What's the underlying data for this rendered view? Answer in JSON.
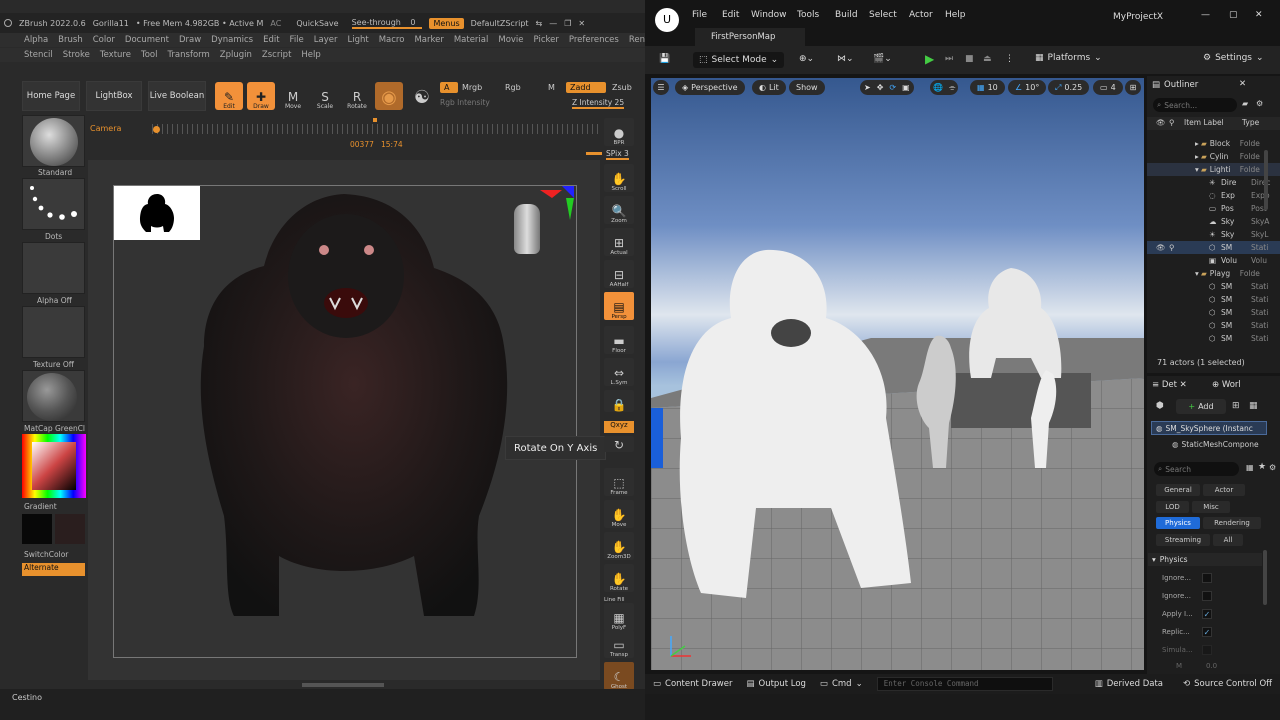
{
  "zbrush": {
    "title": {
      "app": "ZBrush 2022.0.6",
      "doc": "Gorilla11",
      "mem": "• Free Mem 4.982GB • Active M",
      "ac": "AC",
      "quicksave": "QuickSave",
      "seethrough": "See-through",
      "seethrough_val": "0",
      "menus": "Menus",
      "script": "DefaultZScript"
    },
    "menu1": [
      "Alpha",
      "Brush",
      "Color",
      "Document",
      "Draw",
      "Dynamics",
      "Edit",
      "File",
      "Layer",
      "Light",
      "Macro",
      "Marker",
      "Material",
      "Movie",
      "Picker",
      "Preferences",
      "Render"
    ],
    "menu2": [
      "Stencil",
      "Stroke",
      "Texture",
      "Tool",
      "Transform",
      "Zplugin",
      "Zscript",
      "Help"
    ],
    "toolbar": {
      "home": "Home Page",
      "lightbox": "LightBox",
      "livebool": "Live Boolean",
      "edit": "Edit",
      "draw": "Draw",
      "move": "Move",
      "scale": "Scale",
      "rotate": "Rotate",
      "a": "A",
      "mrgb": "Mrgb",
      "rgb": "Rgb",
      "m": "M",
      "zadd": "Zadd",
      "zsub": "Zsub",
      "rgb_intensity": "Rgb Intensity",
      "z_intensity": "Z Intensity 25"
    },
    "timeline": {
      "camera": "Camera",
      "frame": "00377",
      "time": "15:74"
    },
    "left": {
      "standard": "Standard",
      "dots": "Dots",
      "alpha": "Alpha Off",
      "texture": "Texture Off",
      "matcap": "MatCap GreenCl",
      "gradient": "Gradient",
      "switchcolor": "SwitchColor",
      "alternate": "Alternate"
    },
    "right": {
      "bpr": "BPR",
      "spix": "SPix 3",
      "scroll": "Scroll",
      "zoom": "Zoom",
      "actual": "Actual",
      "aahalf": "AAHalf",
      "persp": "Persp",
      "floor": "Floor",
      "lsym": "L.Sym",
      "xyz": "Qxyz",
      "frame": "Frame",
      "move": "Move",
      "zoom3d": "Zoom3D",
      "rotate": "Rotate",
      "linefill": "Line Fill",
      "polyf": "PolyF",
      "transp": "Transp",
      "ghost": "Ghost"
    },
    "tooltip": "Rotate On Y Axis",
    "status": "Cestino"
  },
  "ue": {
    "menu": [
      "File",
      "Edit",
      "Window",
      "Tools",
      "Build",
      "Select",
      "Actor",
      "Help"
    ],
    "project": "MyProjectX",
    "tab": "FirstPersonMap",
    "toolbar": {
      "select_mode": "Select Mode",
      "platforms": "Platforms",
      "settings": "Settings"
    },
    "viewport": {
      "perspective": "Perspective",
      "lit": "Lit",
      "show": "Show",
      "grid": "10",
      "angle": "10°",
      "scale": "0.25",
      "cam": "4"
    },
    "outliner": {
      "title": "Outliner",
      "search": "Search...",
      "col_label": "Item Label",
      "col_type": "Type",
      "rows": [
        {
          "name": "Block",
          "type": "Folde"
        },
        {
          "name": "Cylin",
          "type": "Folde"
        },
        {
          "name": "Lighti",
          "type": "Folde"
        },
        {
          "name": "Dire",
          "type": "Direc"
        },
        {
          "name": "Exp",
          "type": "Expo"
        },
        {
          "name": "Pos",
          "type": "Post"
        },
        {
          "name": "Sky",
          "type": "SkyA"
        },
        {
          "name": "Sky",
          "type": "SkyL"
        },
        {
          "name": "SM",
          "type": "Stati"
        },
        {
          "name": "Volu",
          "type": "Volu"
        },
        {
          "name": "Playg",
          "type": "Folde"
        },
        {
          "name": "SM",
          "type": "Stati"
        },
        {
          "name": "SM",
          "type": "Stati"
        },
        {
          "name": "SM",
          "type": "Stati"
        },
        {
          "name": "SM",
          "type": "Stati"
        },
        {
          "name": "SM",
          "type": "Stati"
        }
      ],
      "count": "71 actors (1 selected)"
    },
    "details": {
      "tab1": "Det",
      "tab2": "Worl",
      "add": "Add",
      "selected": "SM_SkySphere (Instanc",
      "component": "StaticMeshCompone",
      "search": "Search",
      "chips": [
        "General",
        "Actor",
        "LOD",
        "Misc",
        "Physics",
        "Rendering",
        "Streaming",
        "All"
      ],
      "section": "Physics",
      "props": [
        "Ignore...",
        "Ignore...",
        "Apply I...",
        "Replic...",
        "Simula..."
      ],
      "prop_m": "M",
      "prop_m_val": "0.0"
    },
    "statusbar": {
      "drawer": "Content Drawer",
      "log": "Output Log",
      "cmd": "Cmd",
      "console": "Enter Console Command",
      "derived": "Derived Data",
      "source": "Source Control Off"
    }
  }
}
